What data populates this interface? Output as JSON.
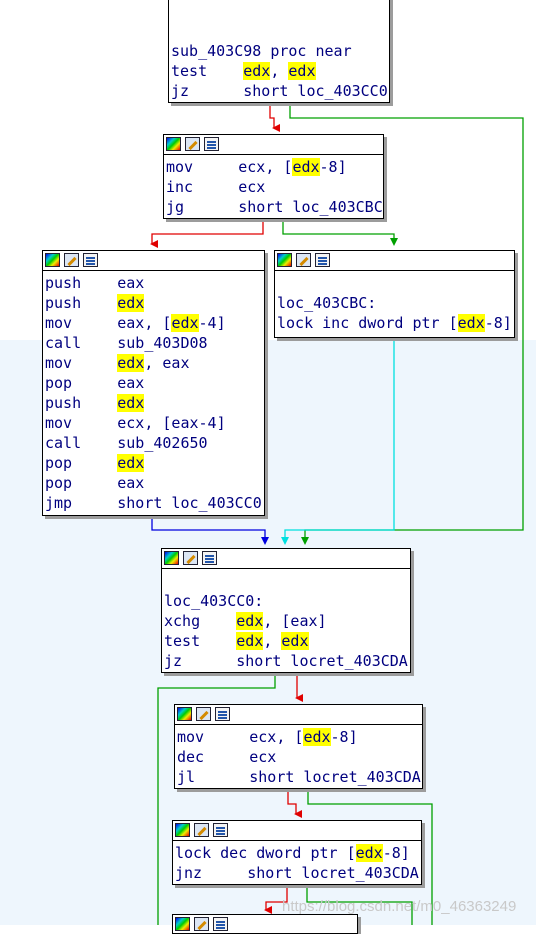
{
  "colors": {
    "true_edge": "#00a000",
    "false_edge": "#e00000",
    "jump_edge": "#0000e0",
    "fall_edge": "#00e0e0",
    "highlight": "#ffff00",
    "code_text": "#00007f"
  },
  "header_icons": [
    "color-palette-icon",
    "edit-pencil-icon",
    "graph-view-icon"
  ],
  "nodes": [
    {
      "id": "block-sub-403c98",
      "header": false,
      "lines": [
        [
          {
            "t": "sub_403C98 proc near"
          }
        ],
        [
          {
            "t": "test    "
          },
          {
            "t": "edx",
            "h": true
          },
          {
            "t": ", "
          },
          {
            "t": "edx",
            "h": true
          }
        ],
        [
          {
            "t": "jz      short loc_403CC0"
          }
        ]
      ]
    },
    {
      "id": "block-mov-ecx",
      "header": true,
      "lines": [
        [
          {
            "t": "mov     ecx, ["
          },
          {
            "t": "edx",
            "h": true
          },
          {
            "t": "-8]"
          }
        ],
        [
          {
            "t": "inc     ecx"
          }
        ],
        [
          {
            "t": "jg      short loc_403CBC"
          }
        ]
      ]
    },
    {
      "id": "block-push-eax",
      "header": true,
      "lines": [
        [
          {
            "t": "push    eax"
          }
        ],
        [
          {
            "t": "push    "
          },
          {
            "t": "edx",
            "h": true
          }
        ],
        [
          {
            "t": "mov     eax, ["
          },
          {
            "t": "edx",
            "h": true
          },
          {
            "t": "-4]"
          }
        ],
        [
          {
            "t": "call    sub_403D08"
          }
        ],
        [
          {
            "t": "mov     "
          },
          {
            "t": "edx",
            "h": true
          },
          {
            "t": ", eax"
          }
        ],
        [
          {
            "t": "pop     eax"
          }
        ],
        [
          {
            "t": "push    "
          },
          {
            "t": "edx",
            "h": true
          }
        ],
        [
          {
            "t": "mov     ecx, [eax-4]"
          }
        ],
        [
          {
            "t": "call    sub_402650"
          }
        ],
        [
          {
            "t": "pop     "
          },
          {
            "t": "edx",
            "h": true
          }
        ],
        [
          {
            "t": "pop     eax"
          }
        ],
        [
          {
            "t": "jmp     short loc_403CC0"
          }
        ]
      ]
    },
    {
      "id": "block-loc-403cbc",
      "header": true,
      "lines": [
        [
          {
            "t": ""
          }
        ],
        [
          {
            "t": "loc_403CBC:"
          }
        ],
        [
          {
            "t": "lock inc dword ptr ["
          },
          {
            "t": "edx",
            "h": true
          },
          {
            "t": "-8]"
          }
        ]
      ]
    },
    {
      "id": "block-loc-403cc0",
      "header": true,
      "lines": [
        [
          {
            "t": ""
          }
        ],
        [
          {
            "t": "loc_403CC0:"
          }
        ],
        [
          {
            "t": "xchg    "
          },
          {
            "t": "edx",
            "h": true
          },
          {
            "t": ", [eax]"
          }
        ],
        [
          {
            "t": "test    "
          },
          {
            "t": "edx",
            "h": true
          },
          {
            "t": ", "
          },
          {
            "t": "edx",
            "h": true
          }
        ],
        [
          {
            "t": "jz      short locret_403CDA"
          }
        ]
      ]
    },
    {
      "id": "block-mov-ecx-dec",
      "header": true,
      "lines": [
        [
          {
            "t": "mov     ecx, ["
          },
          {
            "t": "edx",
            "h": true
          },
          {
            "t": "-8]"
          }
        ],
        [
          {
            "t": "dec     ecx"
          }
        ],
        [
          {
            "t": "jl      short locret_403CDA"
          }
        ]
      ]
    },
    {
      "id": "block-lock-dec",
      "header": true,
      "lines": [
        [
          {
            "t": "lock dec dword ptr ["
          },
          {
            "t": "edx",
            "h": true
          },
          {
            "t": "-8]"
          }
        ],
        [
          {
            "t": "jnz     short locret_403CDA"
          }
        ]
      ]
    },
    {
      "id": "block-next-partial",
      "header": true,
      "lines": []
    }
  ],
  "watermark": "https://blog.csdn.net/m0_46363249"
}
